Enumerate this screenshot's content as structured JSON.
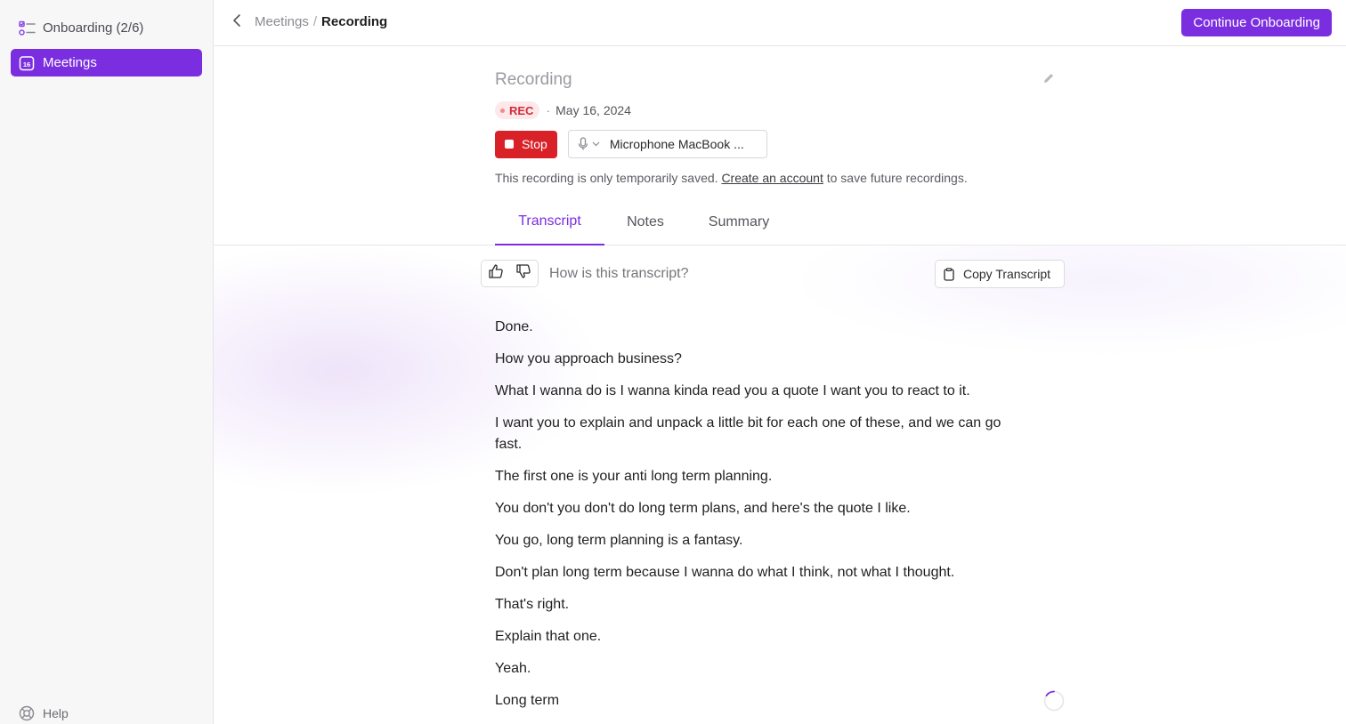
{
  "sidebar": {
    "onboarding_label": "Onboarding (2/6)",
    "meetings_label": "Meetings",
    "meetings_icon_number": "16",
    "help_label": "Help"
  },
  "topbar": {
    "breadcrumb_parent": "Meetings",
    "breadcrumb_separator": "/",
    "breadcrumb_current": "Recording",
    "continue_label": "Continue Onboarding"
  },
  "recording": {
    "title_placeholder": "Recording",
    "rec_badge": "REC",
    "meta_separator": "·",
    "date": "May 16, 2024",
    "stop_label": "Stop",
    "microphone_label": "Microphone MacBook ...",
    "notice_before": "This recording is only temporarily saved.",
    "notice_link": "Create an account",
    "notice_after": "to save future recordings."
  },
  "tabs": [
    {
      "label": "Transcript",
      "active": true
    },
    {
      "label": "Notes",
      "active": false
    },
    {
      "label": "Summary",
      "active": false
    }
  ],
  "feedback": {
    "question": "How is this transcript?",
    "copy_label": "Copy Transcript"
  },
  "transcript": [
    "Done.",
    "How you approach business?",
    "What I wanna do is I wanna kinda read you a quote I want you to react to it.",
    "I want you to explain and unpack a little bit for each one of these, and we can go fast.",
    "The first one is your anti long term planning.",
    "You don't you don't do long term plans, and here's the quote I like.",
    "You go, long term planning is a fantasy.",
    "Don't plan long term because I wanna do what I think, not what I thought.",
    "That's right.",
    "Explain that one.",
    "Yeah.",
    "Long term"
  ],
  "colors": {
    "accent": "#7b2ee0",
    "stop_red": "#d92128",
    "rec_text": "#d42b3a",
    "rec_bg": "#fde8ea"
  },
  "icons": {
    "onboarding": "checklist-icon",
    "meetings": "calendar-icon",
    "help": "lifebuoy-icon",
    "back": "chevron-left-icon",
    "edit": "pencil-icon",
    "microphone": "microphone-icon",
    "thumbs_up": "thumbs-up-icon",
    "thumbs_down": "thumbs-down-icon",
    "copy": "clipboard-icon",
    "loading": "spinner-icon"
  }
}
